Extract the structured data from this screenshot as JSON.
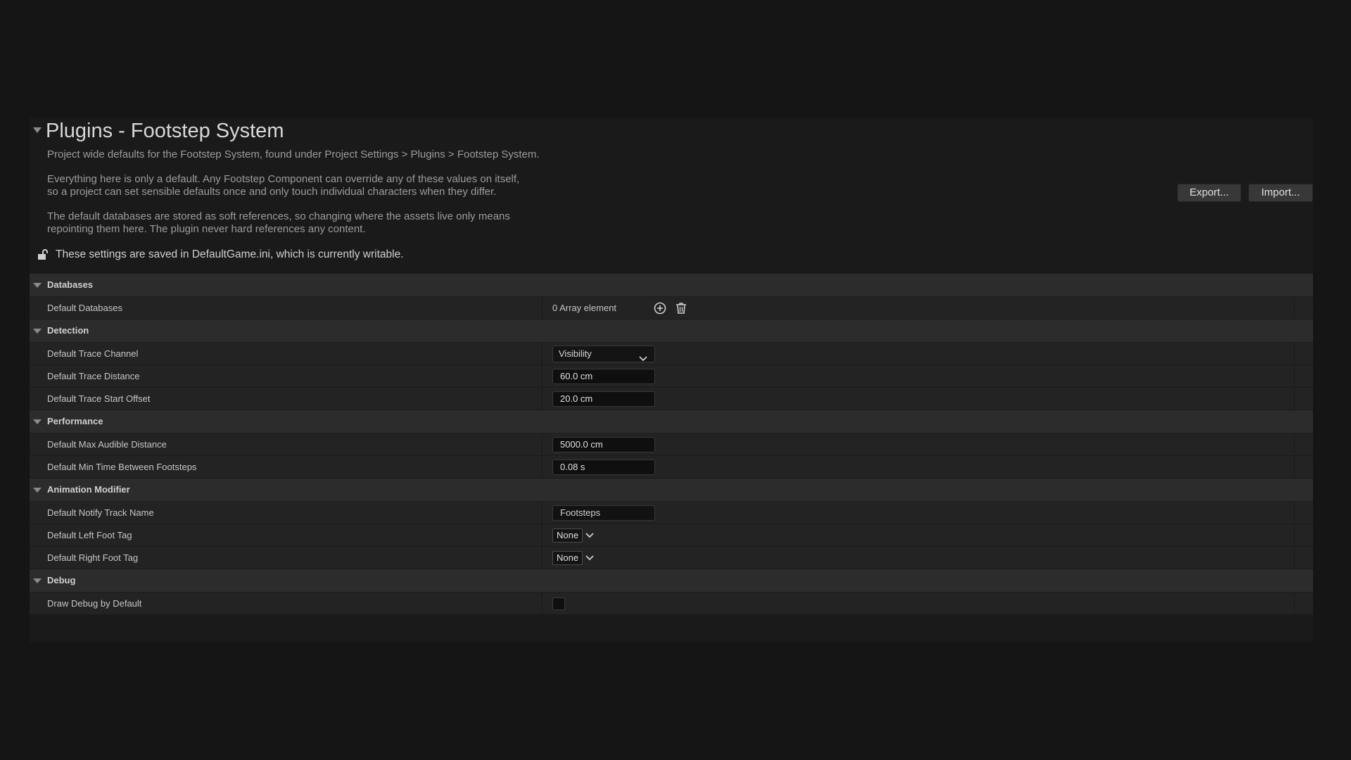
{
  "header": {
    "title": "Plugins - Footstep System",
    "description_1": "Project wide defaults for the Footstep System, found under Project Settings > Plugins > Footstep System.",
    "description_2": "Everything here is only a default. Any Footstep Component can override any of these values on itself,\nso a project can set sensible defaults once and only touch individual characters when they differ.",
    "description_3": "The default databases are stored as soft references, so changing where the assets live only means\nrepointing them here. The plugin never hard references any content.",
    "save_note": "These settings are saved in DefaultGame.ini, which is currently writable.",
    "lock_icon": "unlocked-padlock-icon",
    "export_label": "Export...",
    "import_label": "Import..."
  },
  "categories": {
    "databases": {
      "label": "Databases",
      "default_databases": {
        "name": "Default Databases",
        "value": "0 Array element",
        "add_icon": "plus-circle-icon",
        "delete_icon": "trash-icon"
      }
    },
    "detection": {
      "label": "Detection",
      "trace_channel": {
        "name": "Default Trace Channel",
        "value": "Visibility"
      },
      "trace_distance": {
        "name": "Default Trace Distance",
        "value": "60.0 cm"
      },
      "trace_start_offset": {
        "name": "Default Trace Start Offset",
        "value": "20.0 cm"
      }
    },
    "performance": {
      "label": "Performance",
      "max_audible_distance": {
        "name": "Default Max Audible Distance",
        "value": "5000.0 cm"
      },
      "min_time_between": {
        "name": "Default Min Time Between Footsteps",
        "value": "0.08 s"
      }
    },
    "animation_modifier": {
      "label": "Animation Modifier",
      "notify_track_name": {
        "name": "Default Notify Track Name",
        "value": "Footsteps"
      },
      "left_foot_tag": {
        "name": "Default Left Foot Tag",
        "value": "None"
      },
      "right_foot_tag": {
        "name": "Default Right Foot Tag",
        "value": "None"
      }
    },
    "debug": {
      "label": "Debug",
      "draw_debug": {
        "name": "Draw Debug by Default",
        "checked": false
      }
    }
  }
}
